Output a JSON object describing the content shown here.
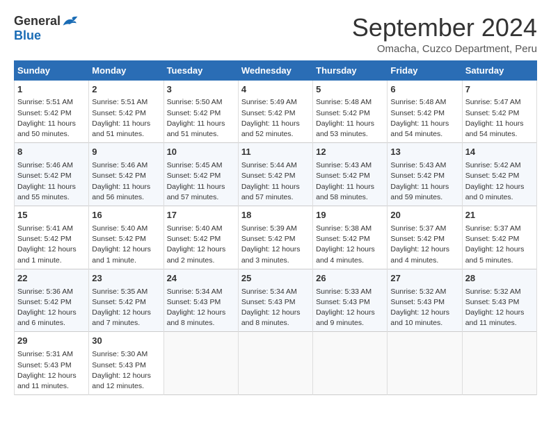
{
  "header": {
    "logo_general": "General",
    "logo_blue": "Blue",
    "month": "September 2024",
    "location": "Omacha, Cuzco Department, Peru"
  },
  "weekdays": [
    "Sunday",
    "Monday",
    "Tuesday",
    "Wednesday",
    "Thursday",
    "Friday",
    "Saturday"
  ],
  "weeks": [
    [
      {
        "day": "1",
        "sunrise": "5:51 AM",
        "sunset": "5:42 PM",
        "daylight": "11 hours and 50 minutes."
      },
      {
        "day": "2",
        "sunrise": "5:51 AM",
        "sunset": "5:42 PM",
        "daylight": "11 hours and 51 minutes."
      },
      {
        "day": "3",
        "sunrise": "5:50 AM",
        "sunset": "5:42 PM",
        "daylight": "11 hours and 51 minutes."
      },
      {
        "day": "4",
        "sunrise": "5:49 AM",
        "sunset": "5:42 PM",
        "daylight": "11 hours and 52 minutes."
      },
      {
        "day": "5",
        "sunrise": "5:48 AM",
        "sunset": "5:42 PM",
        "daylight": "11 hours and 53 minutes."
      },
      {
        "day": "6",
        "sunrise": "5:48 AM",
        "sunset": "5:42 PM",
        "daylight": "11 hours and 54 minutes."
      },
      {
        "day": "7",
        "sunrise": "5:47 AM",
        "sunset": "5:42 PM",
        "daylight": "11 hours and 54 minutes."
      }
    ],
    [
      {
        "day": "8",
        "sunrise": "5:46 AM",
        "sunset": "5:42 PM",
        "daylight": "11 hours and 55 minutes."
      },
      {
        "day": "9",
        "sunrise": "5:46 AM",
        "sunset": "5:42 PM",
        "daylight": "11 hours and 56 minutes."
      },
      {
        "day": "10",
        "sunrise": "5:45 AM",
        "sunset": "5:42 PM",
        "daylight": "11 hours and 57 minutes."
      },
      {
        "day": "11",
        "sunrise": "5:44 AM",
        "sunset": "5:42 PM",
        "daylight": "11 hours and 57 minutes."
      },
      {
        "day": "12",
        "sunrise": "5:43 AM",
        "sunset": "5:42 PM",
        "daylight": "11 hours and 58 minutes."
      },
      {
        "day": "13",
        "sunrise": "5:43 AM",
        "sunset": "5:42 PM",
        "daylight": "11 hours and 59 minutes."
      },
      {
        "day": "14",
        "sunrise": "5:42 AM",
        "sunset": "5:42 PM",
        "daylight": "12 hours and 0 minutes."
      }
    ],
    [
      {
        "day": "15",
        "sunrise": "5:41 AM",
        "sunset": "5:42 PM",
        "daylight": "12 hours and 1 minute."
      },
      {
        "day": "16",
        "sunrise": "5:40 AM",
        "sunset": "5:42 PM",
        "daylight": "12 hours and 1 minute."
      },
      {
        "day": "17",
        "sunrise": "5:40 AM",
        "sunset": "5:42 PM",
        "daylight": "12 hours and 2 minutes."
      },
      {
        "day": "18",
        "sunrise": "5:39 AM",
        "sunset": "5:42 PM",
        "daylight": "12 hours and 3 minutes."
      },
      {
        "day": "19",
        "sunrise": "5:38 AM",
        "sunset": "5:42 PM",
        "daylight": "12 hours and 4 minutes."
      },
      {
        "day": "20",
        "sunrise": "5:37 AM",
        "sunset": "5:42 PM",
        "daylight": "12 hours and 4 minutes."
      },
      {
        "day": "21",
        "sunrise": "5:37 AM",
        "sunset": "5:42 PM",
        "daylight": "12 hours and 5 minutes."
      }
    ],
    [
      {
        "day": "22",
        "sunrise": "5:36 AM",
        "sunset": "5:42 PM",
        "daylight": "12 hours and 6 minutes."
      },
      {
        "day": "23",
        "sunrise": "5:35 AM",
        "sunset": "5:42 PM",
        "daylight": "12 hours and 7 minutes."
      },
      {
        "day": "24",
        "sunrise": "5:34 AM",
        "sunset": "5:43 PM",
        "daylight": "12 hours and 8 minutes."
      },
      {
        "day": "25",
        "sunrise": "5:34 AM",
        "sunset": "5:43 PM",
        "daylight": "12 hours and 8 minutes."
      },
      {
        "day": "26",
        "sunrise": "5:33 AM",
        "sunset": "5:43 PM",
        "daylight": "12 hours and 9 minutes."
      },
      {
        "day": "27",
        "sunrise": "5:32 AM",
        "sunset": "5:43 PM",
        "daylight": "12 hours and 10 minutes."
      },
      {
        "day": "28",
        "sunrise": "5:32 AM",
        "sunset": "5:43 PM",
        "daylight": "12 hours and 11 minutes."
      }
    ],
    [
      {
        "day": "29",
        "sunrise": "5:31 AM",
        "sunset": "5:43 PM",
        "daylight": "12 hours and 11 minutes."
      },
      {
        "day": "30",
        "sunrise": "5:30 AM",
        "sunset": "5:43 PM",
        "daylight": "12 hours and 12 minutes."
      },
      null,
      null,
      null,
      null,
      null
    ]
  ],
  "labels": {
    "sunrise": "Sunrise:",
    "sunset": "Sunset:",
    "daylight": "Daylight:"
  }
}
